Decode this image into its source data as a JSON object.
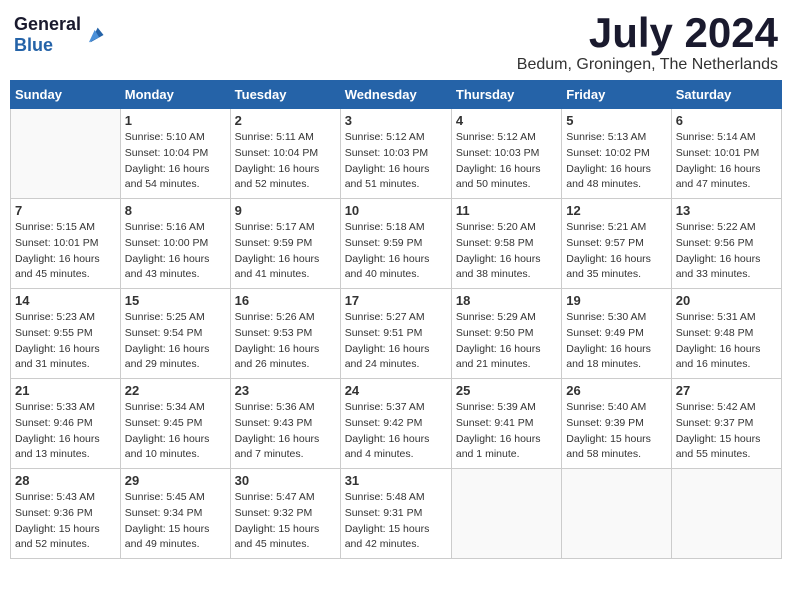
{
  "header": {
    "logo_general": "General",
    "logo_blue": "Blue",
    "month": "July 2024",
    "location": "Bedum, Groningen, The Netherlands"
  },
  "calendar": {
    "columns": [
      "Sunday",
      "Monday",
      "Tuesday",
      "Wednesday",
      "Thursday",
      "Friday",
      "Saturday"
    ],
    "weeks": [
      [
        {
          "day": "",
          "info": ""
        },
        {
          "day": "1",
          "info": "Sunrise: 5:10 AM\nSunset: 10:04 PM\nDaylight: 16 hours\nand 54 minutes."
        },
        {
          "day": "2",
          "info": "Sunrise: 5:11 AM\nSunset: 10:04 PM\nDaylight: 16 hours\nand 52 minutes."
        },
        {
          "day": "3",
          "info": "Sunrise: 5:12 AM\nSunset: 10:03 PM\nDaylight: 16 hours\nand 51 minutes."
        },
        {
          "day": "4",
          "info": "Sunrise: 5:12 AM\nSunset: 10:03 PM\nDaylight: 16 hours\nand 50 minutes."
        },
        {
          "day": "5",
          "info": "Sunrise: 5:13 AM\nSunset: 10:02 PM\nDaylight: 16 hours\nand 48 minutes."
        },
        {
          "day": "6",
          "info": "Sunrise: 5:14 AM\nSunset: 10:01 PM\nDaylight: 16 hours\nand 47 minutes."
        }
      ],
      [
        {
          "day": "7",
          "info": "Sunrise: 5:15 AM\nSunset: 10:01 PM\nDaylight: 16 hours\nand 45 minutes."
        },
        {
          "day": "8",
          "info": "Sunrise: 5:16 AM\nSunset: 10:00 PM\nDaylight: 16 hours\nand 43 minutes."
        },
        {
          "day": "9",
          "info": "Sunrise: 5:17 AM\nSunset: 9:59 PM\nDaylight: 16 hours\nand 41 minutes."
        },
        {
          "day": "10",
          "info": "Sunrise: 5:18 AM\nSunset: 9:59 PM\nDaylight: 16 hours\nand 40 minutes."
        },
        {
          "day": "11",
          "info": "Sunrise: 5:20 AM\nSunset: 9:58 PM\nDaylight: 16 hours\nand 38 minutes."
        },
        {
          "day": "12",
          "info": "Sunrise: 5:21 AM\nSunset: 9:57 PM\nDaylight: 16 hours\nand 35 minutes."
        },
        {
          "day": "13",
          "info": "Sunrise: 5:22 AM\nSunset: 9:56 PM\nDaylight: 16 hours\nand 33 minutes."
        }
      ],
      [
        {
          "day": "14",
          "info": "Sunrise: 5:23 AM\nSunset: 9:55 PM\nDaylight: 16 hours\nand 31 minutes."
        },
        {
          "day": "15",
          "info": "Sunrise: 5:25 AM\nSunset: 9:54 PM\nDaylight: 16 hours\nand 29 minutes."
        },
        {
          "day": "16",
          "info": "Sunrise: 5:26 AM\nSunset: 9:53 PM\nDaylight: 16 hours\nand 26 minutes."
        },
        {
          "day": "17",
          "info": "Sunrise: 5:27 AM\nSunset: 9:51 PM\nDaylight: 16 hours\nand 24 minutes."
        },
        {
          "day": "18",
          "info": "Sunrise: 5:29 AM\nSunset: 9:50 PM\nDaylight: 16 hours\nand 21 minutes."
        },
        {
          "day": "19",
          "info": "Sunrise: 5:30 AM\nSunset: 9:49 PM\nDaylight: 16 hours\nand 18 minutes."
        },
        {
          "day": "20",
          "info": "Sunrise: 5:31 AM\nSunset: 9:48 PM\nDaylight: 16 hours\nand 16 minutes."
        }
      ],
      [
        {
          "day": "21",
          "info": "Sunrise: 5:33 AM\nSunset: 9:46 PM\nDaylight: 16 hours\nand 13 minutes."
        },
        {
          "day": "22",
          "info": "Sunrise: 5:34 AM\nSunset: 9:45 PM\nDaylight: 16 hours\nand 10 minutes."
        },
        {
          "day": "23",
          "info": "Sunrise: 5:36 AM\nSunset: 9:43 PM\nDaylight: 16 hours\nand 7 minutes."
        },
        {
          "day": "24",
          "info": "Sunrise: 5:37 AM\nSunset: 9:42 PM\nDaylight: 16 hours\nand 4 minutes."
        },
        {
          "day": "25",
          "info": "Sunrise: 5:39 AM\nSunset: 9:41 PM\nDaylight: 16 hours\nand 1 minute."
        },
        {
          "day": "26",
          "info": "Sunrise: 5:40 AM\nSunset: 9:39 PM\nDaylight: 15 hours\nand 58 minutes."
        },
        {
          "day": "27",
          "info": "Sunrise: 5:42 AM\nSunset: 9:37 PM\nDaylight: 15 hours\nand 55 minutes."
        }
      ],
      [
        {
          "day": "28",
          "info": "Sunrise: 5:43 AM\nSunset: 9:36 PM\nDaylight: 15 hours\nand 52 minutes."
        },
        {
          "day": "29",
          "info": "Sunrise: 5:45 AM\nSunset: 9:34 PM\nDaylight: 15 hours\nand 49 minutes."
        },
        {
          "day": "30",
          "info": "Sunrise: 5:47 AM\nSunset: 9:32 PM\nDaylight: 15 hours\nand 45 minutes."
        },
        {
          "day": "31",
          "info": "Sunrise: 5:48 AM\nSunset: 9:31 PM\nDaylight: 15 hours\nand 42 minutes."
        },
        {
          "day": "",
          "info": ""
        },
        {
          "day": "",
          "info": ""
        },
        {
          "day": "",
          "info": ""
        }
      ]
    ]
  }
}
